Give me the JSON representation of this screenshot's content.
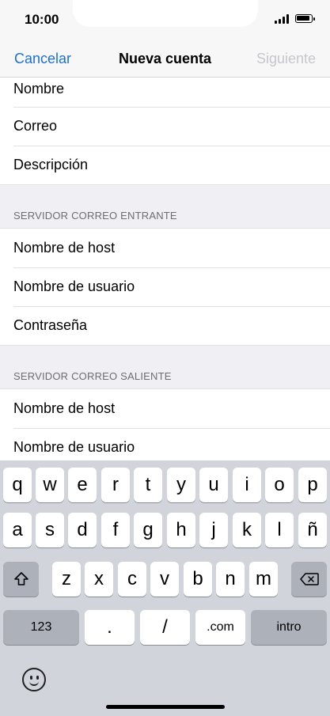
{
  "status_bar": {
    "time": "10:00"
  },
  "nav": {
    "cancel": "Cancelar",
    "title": "Nueva cuenta",
    "next": "Siguiente"
  },
  "account_fields": [
    "Nombre",
    "Correo",
    "Descripción"
  ],
  "incoming": {
    "header": "SERVIDOR CORREO ENTRANTE",
    "fields": [
      "Nombre de host",
      "Nombre de usuario",
      "Contraseña"
    ]
  },
  "outgoing": {
    "header": "SERVIDOR CORREO SALIENTE",
    "fields": [
      "Nombre de host",
      "Nombre de usuario"
    ]
  },
  "keyboard": {
    "row1": [
      "q",
      "w",
      "e",
      "r",
      "t",
      "y",
      "u",
      "i",
      "o",
      "p"
    ],
    "row2": [
      "a",
      "s",
      "d",
      "f",
      "g",
      "h",
      "j",
      "k",
      "l",
      "ñ"
    ],
    "row3": [
      "z",
      "x",
      "c",
      "v",
      "b",
      "n",
      "m"
    ],
    "numbers_key": "123",
    "dot_key": ".",
    "slash_key": "/",
    "com_key": ".com",
    "return_key": "intro"
  },
  "icons": [
    "signal-icon",
    "battery-icon",
    "shift-icon",
    "backspace-icon",
    "emoji-icon"
  ]
}
